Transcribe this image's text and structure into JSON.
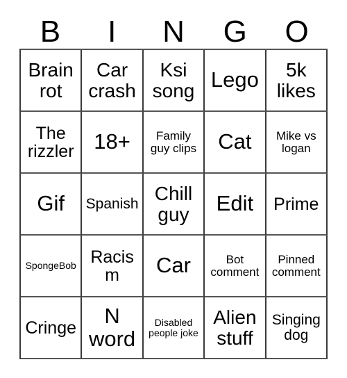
{
  "card": {
    "header_letters": [
      "B",
      "I",
      "N",
      "G",
      "O"
    ],
    "rows": [
      [
        {
          "text": "Brain rot",
          "size": "xl"
        },
        {
          "text": "Car crash",
          "size": "xl"
        },
        {
          "text": "Ksi song",
          "size": "xl"
        },
        {
          "text": "Lego",
          "size": "xxl"
        },
        {
          "text": "5k likes",
          "size": "xl"
        }
      ],
      [
        {
          "text": "The rizzler",
          "size": "lg"
        },
        {
          "text": "18+",
          "size": "xxl"
        },
        {
          "text": "Family guy clips",
          "size": "sm"
        },
        {
          "text": "Cat",
          "size": "xxl"
        },
        {
          "text": "Mike vs logan",
          "size": "sm"
        }
      ],
      [
        {
          "text": "Gif",
          "size": "xxl"
        },
        {
          "text": "Spanish",
          "size": "md"
        },
        {
          "text": "Chill guy",
          "size": "xl"
        },
        {
          "text": "Edit",
          "size": "xxl"
        },
        {
          "text": "Prime",
          "size": "lg"
        }
      ],
      [
        {
          "text": "SpongeBob",
          "size": "xs"
        },
        {
          "text": "Racism",
          "size": "lg"
        },
        {
          "text": "Car",
          "size": "xxl"
        },
        {
          "text": "Bot comment",
          "size": "sm"
        },
        {
          "text": "Pinned comment",
          "size": "sm"
        }
      ],
      [
        {
          "text": "Cringe",
          "size": "lg"
        },
        {
          "text": "N word",
          "size": "xxl"
        },
        {
          "text": "Disabled people joke",
          "size": "xs"
        },
        {
          "text": "Alien stuff",
          "size": "xl"
        },
        {
          "text": "Singing dog",
          "size": "md"
        }
      ]
    ]
  }
}
